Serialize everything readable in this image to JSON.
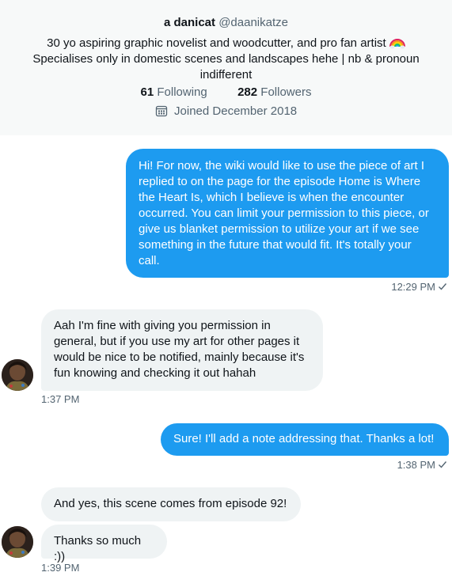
{
  "profile": {
    "display_name": "a danicat",
    "handle": "@daanikatze",
    "bio_line1": "30 yo aspiring graphic novelist and woodcutter, and pro fan artist",
    "bio_line2": "Specialises only in domestic scenes and landscapes hehe | nb & pronoun",
    "bio_line3": "indifferent",
    "following_count": "61",
    "following_label": "Following",
    "followers_count": "282",
    "followers_label": "Followers",
    "joined": "Joined December 2018"
  },
  "messages": [
    {
      "from": "me",
      "lines": [
        "Hi! For now, the wiki would like to use the piece of art I",
        "replied to on the page for the episode Home is Where",
        "the Heart Is, which I believe is when the encounter",
        "occurred. You can limit your permission to this piece, or",
        "give us blanket permission to utilize your art if we see",
        "something in the future that would fit. It's totally your",
        "call."
      ],
      "time": "12:29 PM"
    },
    {
      "from": "them",
      "lines": [
        "Aah I'm fine with giving you permission in",
        "general, but if you use my art for other pages it",
        "would be nice to be notified, mainly because it's",
        "fun knowing and checking it out hahah"
      ],
      "time": "1:37 PM"
    },
    {
      "from": "me",
      "lines": [
        "Sure! I'll add a note addressing that. Thanks a lot!"
      ],
      "time": "1:38 PM"
    },
    {
      "from": "them",
      "lines": [
        "And yes, this scene comes from episode 92!"
      ]
    },
    {
      "from": "them",
      "lines": [
        "Thanks so much :))"
      ],
      "time": "1:39 PM"
    }
  ],
  "colors": {
    "accent": "#1d9bf0",
    "incoming_bg": "#eff3f4",
    "muted": "#536471",
    "header_bg": "#f7f9f9"
  }
}
